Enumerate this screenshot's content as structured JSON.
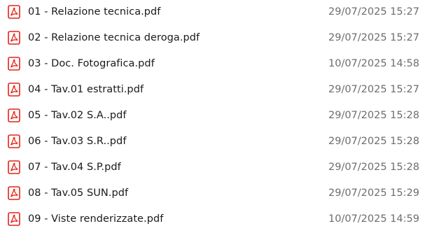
{
  "files": [
    {
      "name": "01 - Relazione tecnica.pdf",
      "modified": "29/07/2025 15:27",
      "icon": "pdf-file-icon"
    },
    {
      "name": "02 - Relazione tecnica deroga.pdf",
      "modified": "29/07/2025 15:27",
      "icon": "pdf-file-icon"
    },
    {
      "name": "03 - Doc. Fotografica.pdf",
      "modified": "10/07/2025 14:58",
      "icon": "pdf-file-icon"
    },
    {
      "name": "04 - Tav.01 estratti.pdf",
      "modified": "29/07/2025 15:27",
      "icon": "pdf-file-icon"
    },
    {
      "name": "05 - Tav.02 S.A..pdf",
      "modified": "29/07/2025 15:28",
      "icon": "pdf-file-icon"
    },
    {
      "name": "06 - Tav.03 S.R..pdf",
      "modified": "29/07/2025 15:28",
      "icon": "pdf-file-icon"
    },
    {
      "name": "07 - Tav.04 S.P.pdf",
      "modified": "29/07/2025 15:28",
      "icon": "pdf-file-icon"
    },
    {
      "name": "08 - Tav.05 SUN.pdf",
      "modified": "29/07/2025 15:29",
      "icon": "pdf-file-icon"
    },
    {
      "name": "09 - Viste renderizzate.pdf",
      "modified": "10/07/2025 14:59",
      "icon": "pdf-file-icon"
    }
  ],
  "colors": {
    "pdf_icon": "#e2231a",
    "name_text": "#1a1a1a",
    "date_text": "#6d6d6d",
    "background": "#ffffff"
  }
}
